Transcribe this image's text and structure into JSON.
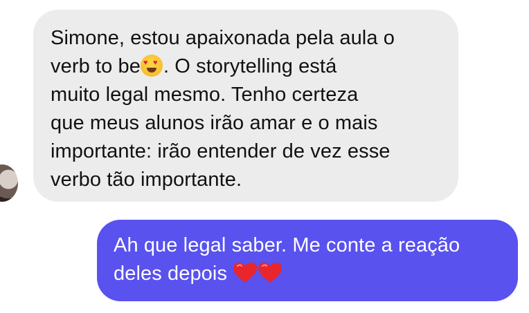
{
  "conversation": {
    "incoming": {
      "lines": [
        "Simone, estou apaixonada pela aula o",
        "verb to be",
        ". O storytelling está",
        "muito legal mesmo. Tenho certeza",
        "que meus alunos irão amar e o mais",
        "importante:  irão entender de vez esse",
        "verbo tão importante."
      ],
      "emoji": "heart-eyes-emoji",
      "bubble_color": "#ececec"
    },
    "outgoing": {
      "lines": [
        "Ah que legal saber. Me conte a reação",
        "deles depois"
      ],
      "emoji": "red-heart-emoji",
      "bubble_color": "#5952ef"
    }
  }
}
